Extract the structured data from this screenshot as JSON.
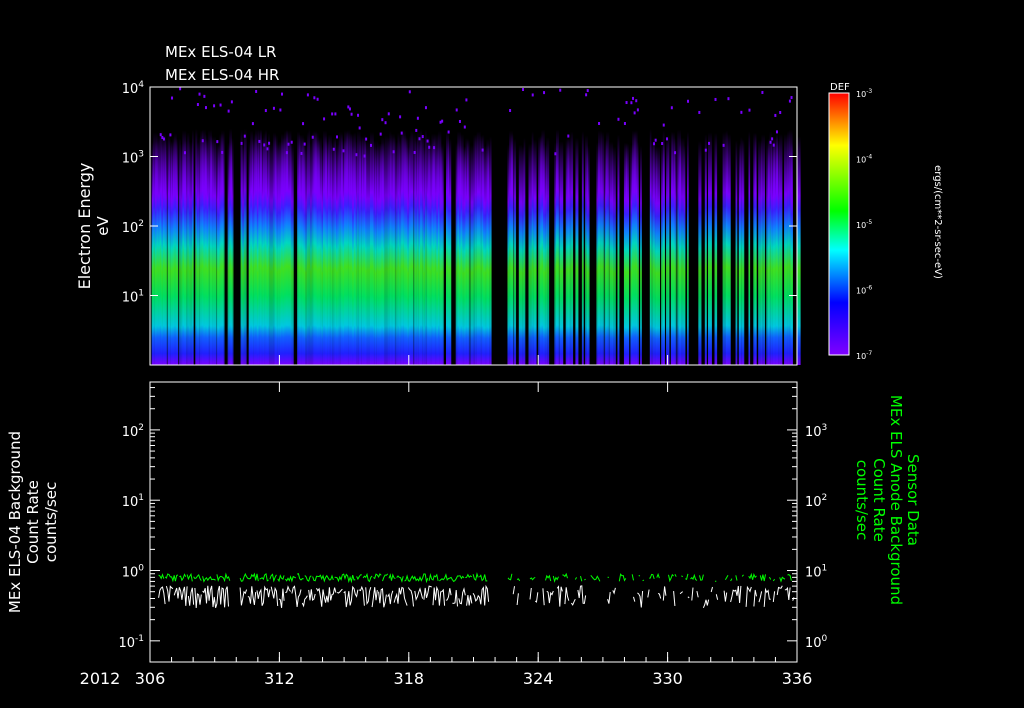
{
  "chart_data": [
    {
      "type": "heatmap",
      "titles": [
        "MEx ELS-04 LR",
        "MEx ELS-04 HR"
      ],
      "ylabel": "Electron Energy",
      "yunit": "eV",
      "yscale": "log",
      "ylim": [
        1,
        10000
      ],
      "yticks": [
        {
          "b": "10",
          "e": "1",
          "v": 10
        },
        {
          "b": "10",
          "e": "2",
          "v": 100
        },
        {
          "b": "10",
          "e": "3",
          "v": 1000
        },
        {
          "b": "10",
          "e": "4",
          "v": 10000
        }
      ],
      "xlim": [
        306,
        336
      ],
      "data_gaps_days": [
        [
          309.75,
          310.15
        ],
        [
          321.75,
          322.55
        ]
      ],
      "spectrum_peak_energy_eV": 40,
      "colorbar": {
        "label": "DEF",
        "unit": "ergs/(cm**2-sr-sec-eV)",
        "scale": "log",
        "range": [
          1e-07,
          0.001
        ],
        "ticks": [
          {
            "b": "10",
            "e": "-7"
          },
          {
            "b": "10",
            "e": "-6"
          },
          {
            "b": "10",
            "e": "-5"
          },
          {
            "b": "10",
            "e": "-4"
          },
          {
            "b": "10",
            "e": "-3"
          }
        ]
      }
    },
    {
      "type": "line",
      "ylabel_left": [
        "MEx ELS-04 Background",
        "Count Rate",
        "counts/sec"
      ],
      "ylabel_right": [
        "Sensor Data",
        "MEx ELS Anode Background",
        "Count Rate",
        "counts/sec"
      ],
      "yscale": "log",
      "ylim_left": [
        0.05,
        480
      ],
      "ylim_right": [
        0.5,
        4800
      ],
      "yticks_left": [
        {
          "b": "10",
          "e": "-1"
        },
        {
          "b": "10",
          "e": "0"
        },
        {
          "b": "10",
          "e": "1"
        },
        {
          "b": "10",
          "e": "2"
        }
      ],
      "yticks_right": [
        {
          "b": "10",
          "e": "0"
        },
        {
          "b": "10",
          "e": "1"
        },
        {
          "b": "10",
          "e": "2"
        },
        {
          "b": "10",
          "e": "3"
        }
      ],
      "xlim": [
        306,
        336
      ],
      "year": "2012",
      "xticks": [
        "306",
        "312",
        "318",
        "324",
        "330",
        "336"
      ],
      "series": [
        {
          "name": "ELS-04 background (left axis)",
          "color": "#ffffff",
          "typical": 0.45,
          "range": [
            0.25,
            0.65
          ]
        },
        {
          "name": "Anode background (right axis)",
          "color": "#00ff00",
          "typical": 8,
          "range": [
            6.5,
            12
          ]
        }
      ]
    }
  ]
}
